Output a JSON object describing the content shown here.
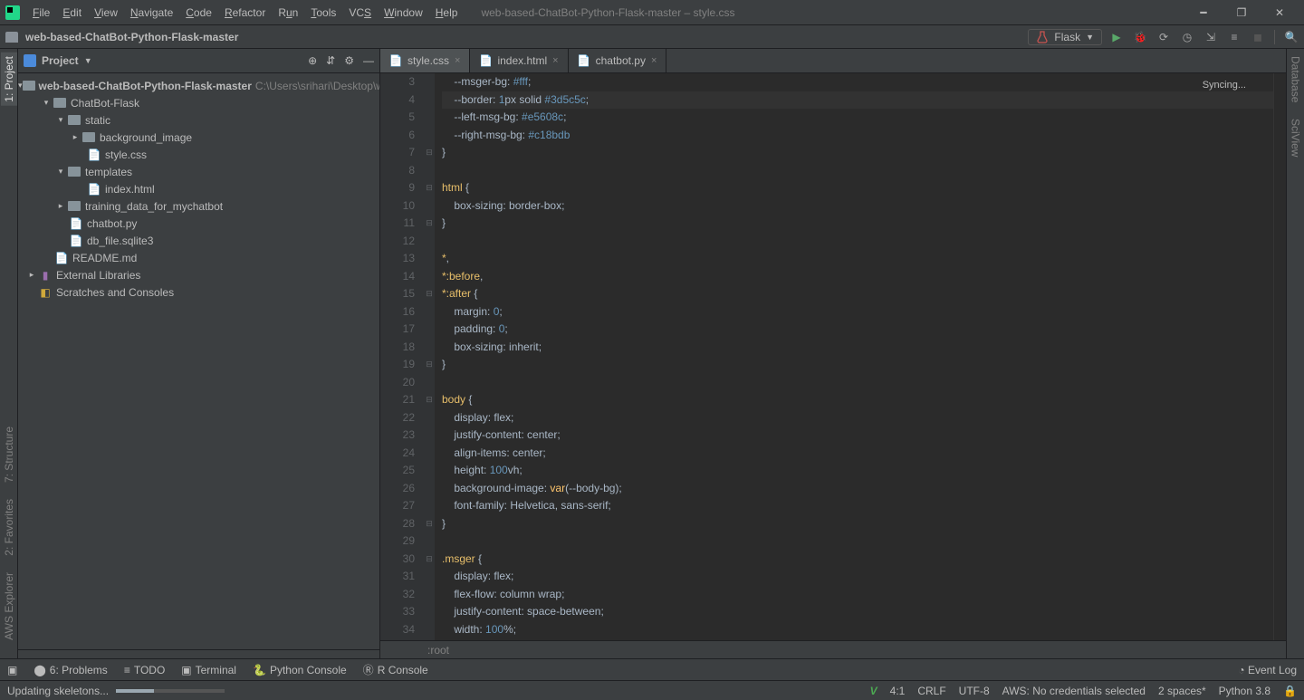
{
  "window": {
    "title": "web-based-ChatBot-Python-Flask-master – style.css"
  },
  "menu": [
    "File",
    "Edit",
    "View",
    "Navigate",
    "Code",
    "Refactor",
    "Run",
    "Tools",
    "VCS",
    "Window",
    "Help"
  ],
  "breadcrumb": {
    "root": "web-based-ChatBot-Python-Flask-master"
  },
  "run_config": {
    "label": "Flask"
  },
  "left_strip": {
    "project": "1: Project",
    "structure": "7: Structure",
    "favorites": "2: Favorites",
    "aws": "AWS Explorer"
  },
  "right_strip": {
    "database": "Database",
    "sciview": "SciView"
  },
  "project_panel": {
    "title": "Project",
    "root": {
      "name": "web-based-ChatBot-Python-Flask-master",
      "path": "C:\\Users\\srihari\\Desktop\\we"
    },
    "nodes": {
      "chatbot_flask": "ChatBot-Flask",
      "static": "static",
      "background_image": "background_image",
      "style_css": "style.css",
      "templates": "templates",
      "index_html": "index.html",
      "training_data": "training_data_for_mychatbot",
      "chatbot_py": "chatbot.py",
      "db_file": "db_file.sqlite3",
      "readme": "README.md",
      "ext_libs": "External Libraries",
      "scratches": "Scratches and Consoles"
    }
  },
  "tabs": [
    {
      "label": "style.css",
      "active": true
    },
    {
      "label": "index.html",
      "active": false
    },
    {
      "label": "chatbot.py",
      "active": false
    }
  ],
  "editor": {
    "sync": "Syncing...",
    "breadcrumb": ":root",
    "first_line": 3,
    "lines": [
      "    --msger-bg: #fff;",
      "    --border: 1px solid #3d5c5c;",
      "    --left-msg-bg: #e5608c;",
      "    --right-msg-bg: #c18bdb",
      "}",
      "",
      "html {",
      "    box-sizing: border-box;",
      "}",
      "",
      "*,",
      "*:before,",
      "*:after {",
      "    margin: 0;",
      "    padding: 0;",
      "    box-sizing: inherit;",
      "}",
      "",
      "body {",
      "    display: flex;",
      "    justify-content: center;",
      "    align-items: center;",
      "    height: 100vh;",
      "    background-image: var(--body-bg);",
      "    font-family: Helvetica, sans-serif;",
      "}",
      "",
      ".msger {",
      "    display: flex;",
      "    flex-flow: column wrap;",
      "    justify-content: space-between;",
      "    width: 100%;"
    ]
  },
  "bottom_tools": {
    "problems": "6: Problems",
    "todo": "TODO",
    "terminal": "Terminal",
    "py_console": "Python Console",
    "r_console": "R Console",
    "event_log": "Event Log"
  },
  "status": {
    "updating": "Updating skeletons...",
    "pos": "4:1",
    "eol": "CRLF",
    "enc": "UTF-8",
    "aws": "AWS: No credentials selected",
    "indent": "2 spaces*",
    "python": "Python 3.8"
  }
}
